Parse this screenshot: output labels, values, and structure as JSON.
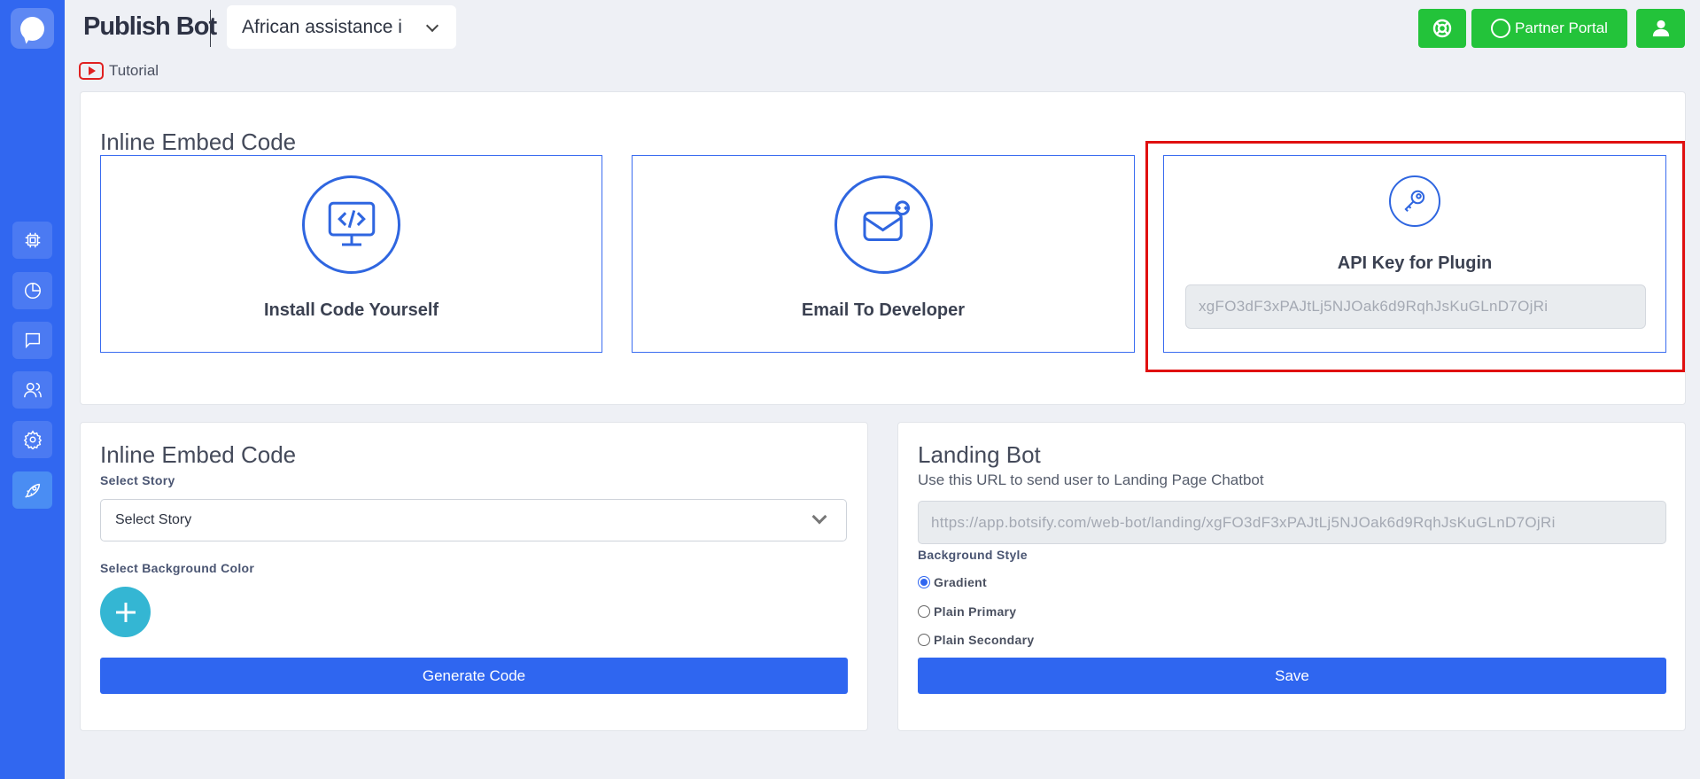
{
  "header": {
    "brand": "Publish Bot",
    "bot_name": "African assistance i",
    "tutorial_label": "Tutorial",
    "partner_portal_label": "Partner Portal"
  },
  "sidebar": {
    "items": [
      {
        "icon": "chip-icon"
      },
      {
        "icon": "pie-chart-icon"
      },
      {
        "icon": "chat-icon"
      },
      {
        "icon": "users-icon"
      },
      {
        "icon": "gear-icon"
      },
      {
        "icon": "rocket-icon",
        "active": true
      }
    ]
  },
  "embed": {
    "title": "Inline Embed Code",
    "options": [
      {
        "label": "Install Code Yourself",
        "icon": "code-monitor-icon"
      },
      {
        "label": "Email To Developer",
        "icon": "email-code-icon"
      },
      {
        "label": "API Key for Plugin",
        "icon": "key-icon"
      }
    ],
    "api_key": "xgFO3dF3xPAJtLj5NJOak6d9RqhJsKuGLnD7OjRi"
  },
  "inline_embed": {
    "title": "Inline Embed Code",
    "story_label": "Select Story",
    "story_value": "Select Story",
    "bg_color_label": "Select Background Color",
    "bg_color": "#34b6d3",
    "generate_label": "Generate Code"
  },
  "landing": {
    "title": "Landing Bot",
    "subtitle": "Use this URL to send user to Landing Page Chatbot",
    "url": "https://app.botsify.com/web-bot/landing/xgFO3dF3xPAJtLj5NJOak6d9RqhJsKuGLnD7OjRi",
    "bg_style_label": "Background Style",
    "options": [
      "Gradient",
      "Plain Primary",
      "Plain Secondary"
    ],
    "selected": "Gradient",
    "save_label": "Save"
  },
  "colors": {
    "primary": "#2f66f0",
    "sidebar": "#3167f0",
    "success": "#23c33a",
    "highlight": "#e01010"
  }
}
